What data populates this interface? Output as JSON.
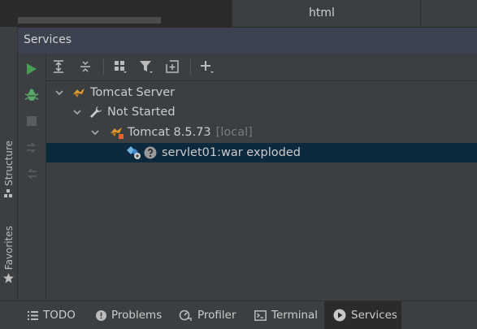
{
  "editor": {
    "tab_label": "html"
  },
  "left_stripe": {
    "structure_label": "Structure",
    "favorites_label": "Favorites"
  },
  "services": {
    "title": "Services"
  },
  "tree": {
    "root": {
      "label": "Tomcat Server"
    },
    "group": {
      "label": "Not Started"
    },
    "server": {
      "label": "Tomcat 8.5.73",
      "suffix": "[local]"
    },
    "artifact": {
      "label": "servlet01:war exploded"
    }
  },
  "bottom_tabs": [
    {
      "label": "TODO"
    },
    {
      "label": "Problems"
    },
    {
      "label": "Profiler"
    },
    {
      "label": "Terminal"
    },
    {
      "label": "Services"
    }
  ],
  "colors": {
    "run_green": "#499c54",
    "bug_green": "#59a869",
    "selection": "#0d293e",
    "header": "#3c4250",
    "tomcat_orange": "#e0982d"
  },
  "icons": [
    "run-icon",
    "debug-icon",
    "stop-icon",
    "expand-all-icon",
    "collapse-all-icon",
    "group-by-icon",
    "filter-icon",
    "new-service-icon",
    "add-icon",
    "tomcat-icon",
    "wrench-icon",
    "artifact-icon",
    "help-icon"
  ]
}
